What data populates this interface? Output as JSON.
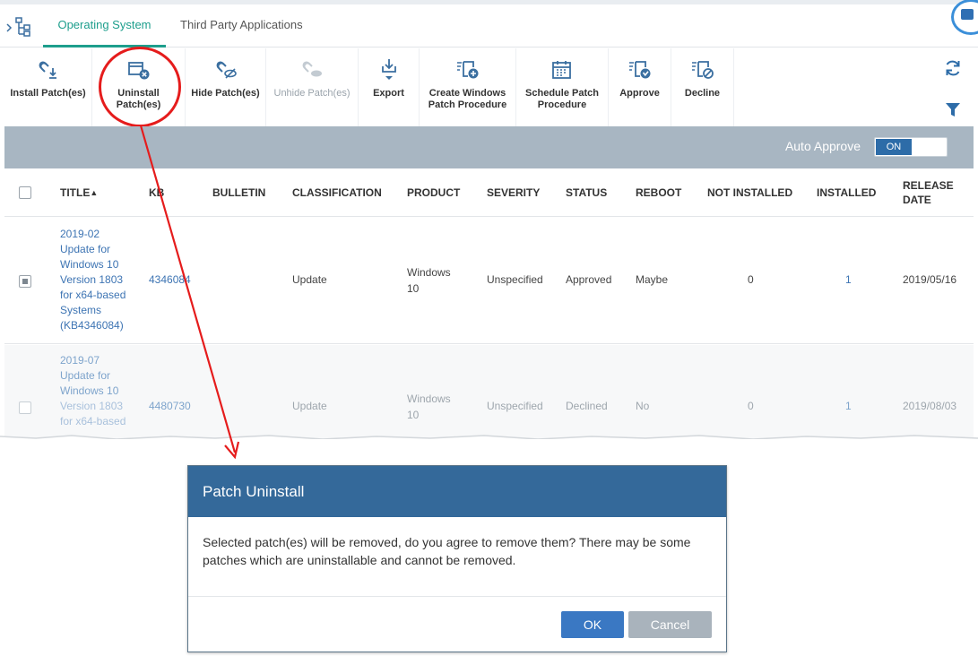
{
  "tabs": [
    {
      "label": "Operating System",
      "active": true
    },
    {
      "label": "Third Party Applications",
      "active": false
    }
  ],
  "toolbar": {
    "buttons": [
      {
        "label": "Install Patch(es)",
        "icon": "install-patch-icon",
        "enabled": true
      },
      {
        "label": "Uninstall\nPatch(es)",
        "icon": "uninstall-patch-icon",
        "enabled": true
      },
      {
        "label": "Hide Patch(es)",
        "icon": "hide-patch-icon",
        "enabled": true
      },
      {
        "label": "Unhide Patch(es)",
        "icon": "unhide-patch-icon",
        "enabled": false
      },
      {
        "label": "Export",
        "icon": "export-icon",
        "enabled": true
      },
      {
        "label": "Create Windows\nPatch Procedure",
        "icon": "create-procedure-icon",
        "enabled": true
      },
      {
        "label": "Schedule Patch\nProcedure",
        "icon": "calendar-icon",
        "enabled": true
      },
      {
        "label": "Approve",
        "icon": "approve-icon",
        "enabled": true
      },
      {
        "label": "Decline",
        "icon": "decline-icon",
        "enabled": true
      }
    ]
  },
  "auto_approve": {
    "label": "Auto Approve",
    "state": "ON"
  },
  "table": {
    "columns": [
      "TITLE",
      "KB",
      "BULLETIN",
      "CLASSIFICATION",
      "PRODUCT",
      "SEVERITY",
      "STATUS",
      "REBOOT",
      "NOT INSTALLED",
      "INSTALLED",
      "RELEASE\nDATE"
    ],
    "sort_indicator": "▲",
    "rows": [
      {
        "title_lines": [
          "2019-02",
          "Update for",
          "Windows 10",
          "Version 1803",
          "for x64-based",
          "Systems",
          "(KB4346084)"
        ],
        "kb": "4346084",
        "bulletin": "",
        "classification": "Update",
        "product": "Windows\n10",
        "severity": "Unspecified",
        "status": "Approved",
        "reboot": "Maybe",
        "not_installed": "0",
        "installed": "1",
        "release_date": "2019/05/16",
        "checked": true
      },
      {
        "title_lines": [
          "2019-07",
          "Update for",
          "Windows 10",
          "Version 1803",
          "for x64-based"
        ],
        "kb": "4480730",
        "bulletin": "",
        "classification": "Update",
        "product": "Windows\n10",
        "severity": "Unspecified",
        "status": "Declined",
        "reboot": "No",
        "not_installed": "0",
        "installed": "1",
        "release_date": "2019/08/03",
        "checked": false
      }
    ]
  },
  "dialog": {
    "title": "Patch Uninstall",
    "message_line1": "Selected patch(es) will be removed, do you agree to remove them? There may be some",
    "message_line2": "patches which are uninstallable and cannot be removed.",
    "ok_label": "OK",
    "cancel_label": "Cancel"
  },
  "colors": {
    "accent": "#1d9e8c",
    "dialog_header": "#34699a",
    "annotation": "#e51c1c",
    "link": "#3d74b3"
  }
}
